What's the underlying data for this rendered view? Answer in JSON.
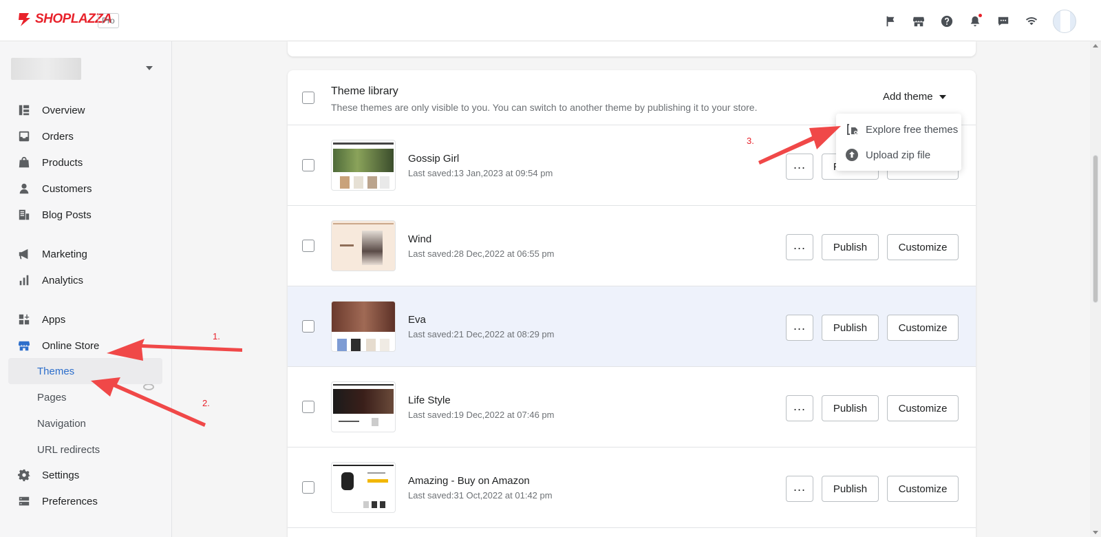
{
  "brand": {
    "logo_text": "SHOPLAZZA",
    "plan_badge": "Pro"
  },
  "topbar": {
    "icons": [
      "flag-icon",
      "storefront-icon",
      "help-icon",
      "bell-icon",
      "chat-icon",
      "wifi-icon"
    ],
    "has_notification_dot": true
  },
  "sidebar": {
    "items": [
      {
        "label": "Overview",
        "icon": "overview-icon"
      },
      {
        "label": "Orders",
        "icon": "inbox-icon"
      },
      {
        "label": "Products",
        "icon": "bag-icon"
      },
      {
        "label": "Customers",
        "icon": "person-icon"
      },
      {
        "label": "Blog Posts",
        "icon": "blog-icon"
      },
      {
        "label": "Marketing",
        "icon": "megaphone-icon"
      },
      {
        "label": "Analytics",
        "icon": "bar-chart-icon"
      },
      {
        "label": "Apps",
        "icon": "apps-icon"
      },
      {
        "label": "Online Store",
        "icon": "store-icon"
      },
      {
        "label": "Settings",
        "icon": "gear-icon"
      },
      {
        "label": "Preferences",
        "icon": "server-icon"
      }
    ],
    "online_store_sub": [
      {
        "label": "Themes",
        "active": true
      },
      {
        "label": "Pages",
        "active": false
      },
      {
        "label": "Navigation",
        "active": false
      },
      {
        "label": "URL redirects",
        "active": false
      }
    ]
  },
  "library": {
    "title": "Theme library",
    "description": "These themes are only visible to you. You can switch to another theme by publishing it to your store.",
    "add_theme_label": "Add theme",
    "publish_label": "Publish",
    "customize_label": "Customize",
    "themes": [
      {
        "name": "Gossip Girl",
        "saved": "Last saved:13 Jan,2023 at 09:54 pm",
        "highlighted": false
      },
      {
        "name": "Wind",
        "saved": "Last saved:28 Dec,2022 at 06:55 pm",
        "highlighted": false
      },
      {
        "name": "Eva",
        "saved": "Last saved:21 Dec,2022 at 08:29 pm",
        "highlighted": true
      },
      {
        "name": "Life Style",
        "saved": "Last saved:19 Dec,2022 at 07:46 pm",
        "highlighted": false
      },
      {
        "name": "Amazing - Buy on Amazon",
        "saved": "Last saved:31 Oct,2022 at 01:42 pm",
        "highlighted": false
      }
    ]
  },
  "dropdown": {
    "items": [
      {
        "label": "Explore free themes",
        "icon": "theme-tag-icon"
      },
      {
        "label": "Upload zip file",
        "icon": "upload-icon"
      }
    ]
  },
  "annotations": {
    "step1": "1.",
    "step2": "2.",
    "step3": "3."
  },
  "colors": {
    "brand_red": "#e8222b",
    "active_blue": "#2c6ecb",
    "highlight_row": "#eef2fb"
  }
}
